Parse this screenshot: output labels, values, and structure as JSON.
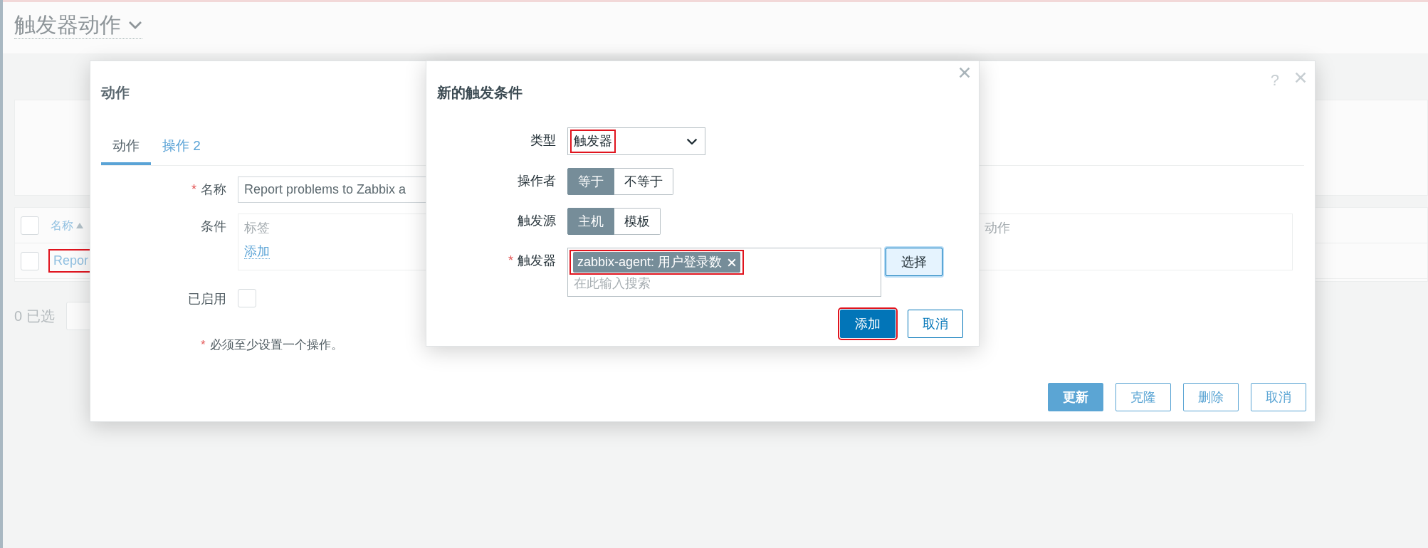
{
  "page": {
    "title": "触发器动作"
  },
  "required_mark": "*",
  "background_table": {
    "select_all_checked": false,
    "columns": [
      {
        "label": "名称",
        "sorted": true
      }
    ],
    "rows": [
      {
        "name": "Repor",
        "highlighted": true,
        "checked": false
      }
    ]
  },
  "selection": {
    "count_text": "0 已选"
  },
  "action_dialog": {
    "title": "动作",
    "help": "?",
    "tabs": [
      {
        "label": "动作",
        "selected": true
      },
      {
        "label": "操作 2",
        "selected": false
      }
    ],
    "name": {
      "label": "名称",
      "required": true,
      "value": "Report problems to Zabbix a"
    },
    "conditions": {
      "label": "条件",
      "columns": [
        "标签",
        "动作"
      ],
      "add_link": "添加"
    },
    "enabled": {
      "label": "已启用",
      "checked": false
    },
    "note": "必须至少设置一个操作。",
    "buttons": [
      {
        "label": "更新",
        "kind": "primary"
      },
      {
        "label": "克隆",
        "kind": "secondary"
      },
      {
        "label": "删除",
        "kind": "secondary"
      },
      {
        "label": "取消",
        "kind": "secondary"
      }
    ]
  },
  "condition_dialog": {
    "title": "新的触发条件",
    "type": {
      "label": "类型",
      "value": "触发器",
      "highlighted": true
    },
    "operator": {
      "label": "操作者",
      "options": [
        {
          "label": "等于",
          "selected": true
        },
        {
          "label": "不等于",
          "selected": false
        }
      ]
    },
    "source": {
      "label": "触发源",
      "options": [
        {
          "label": "主机",
          "selected": true
        },
        {
          "label": "模板",
          "selected": false
        }
      ]
    },
    "trigger": {
      "label": "触发器",
      "required": true,
      "highlighted": true,
      "tags": [
        {
          "label": "zabbix-agent: 用户登录数"
        }
      ],
      "placeholder": "在此输入搜索",
      "select_button": "选择"
    },
    "buttons": [
      {
        "label": "添加",
        "kind": "primary",
        "highlighted": true
      },
      {
        "label": "取消",
        "kind": "secondary",
        "highlighted": false
      }
    ]
  }
}
